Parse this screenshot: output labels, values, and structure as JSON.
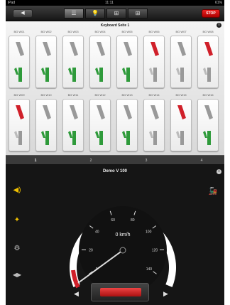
{
  "statusbar": {
    "left": "iPad",
    "time": "11:11",
    "right": "61%"
  },
  "toolbar": {
    "back_label": "◀",
    "segments": [
      "☰",
      "💡",
      "⊞",
      "⊞"
    ],
    "stop_label": "STOP"
  },
  "keyboard": {
    "title": "Keyboard Seite 1",
    "row1_labels": [
      "BG W01",
      "BG W02",
      "BG W03",
      "BG W04",
      "BG W05",
      "BG W06",
      "BG W07",
      "BG W08"
    ],
    "row2_labels": [
      "BG W09",
      "BG W10",
      "BG W11",
      "BG W12",
      "BG W13",
      "BG W14",
      "BG W15",
      "BG W16"
    ],
    "row1_states": [
      "green",
      "green",
      "green",
      "green",
      "green",
      "red",
      "gray",
      "red"
    ],
    "row2_states": [
      "red",
      "green",
      "green",
      "green",
      "green",
      "gray",
      "red",
      "green"
    ]
  },
  "pager": {
    "pages": [
      "1",
      "2",
      "3",
      "4"
    ],
    "active_index": 0
  },
  "loco": {
    "name": "Demo V 100",
    "speed_text": "0 km/h",
    "speed_ticks": [
      "0",
      "20",
      "40",
      "60",
      "80",
      "100",
      "120",
      "140"
    ],
    "direction_left_symbol": "◀",
    "direction_right_symbol": "▶"
  },
  "colors": {
    "accent_red": "#d0202a",
    "accent_green": "#2e9a3a",
    "stop_red": "#dd2222"
  }
}
